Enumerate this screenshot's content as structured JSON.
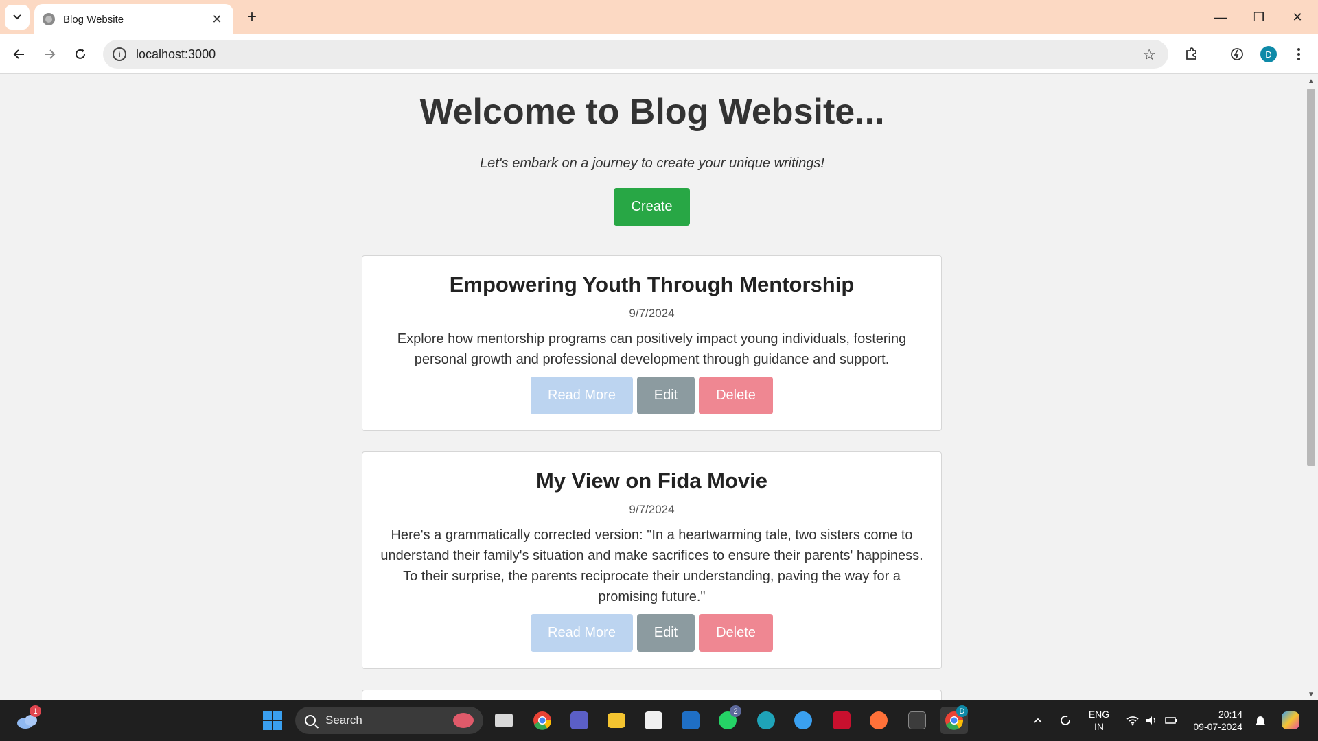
{
  "browser": {
    "tab_title": "Blog Website",
    "tab_close": "✕",
    "new_tab": "+",
    "url": "localhost:3000",
    "window_controls": {
      "minimize": "—",
      "restore": "❐",
      "close": "✕"
    },
    "profile_initial": "D"
  },
  "page": {
    "title": "Welcome to Blog Website...",
    "tagline": "Let's embark on a journey to create your unique writings!",
    "create_label": "Create",
    "posts": [
      {
        "title": "Empowering Youth Through Mentorship",
        "date": "9/7/2024",
        "description": "Explore how mentorship programs can positively impact young individuals, fostering personal growth and professional development through guidance and support.",
        "read_more": "Read More",
        "edit": "Edit",
        "delete": "Delete"
      },
      {
        "title": "My View on Fida Movie",
        "date": "9/7/2024",
        "description": "Here's a grammatically corrected version: \"In a heartwarming tale, two sisters come to understand their family's situation and make sacrifices to ensure their parents' happiness. To their surprise, the parents reciprocate their understanding, paving the way for a promising future.\"",
        "read_more": "Read More",
        "edit": "Edit",
        "delete": "Delete"
      }
    ]
  },
  "taskbar": {
    "weather_badge": "1",
    "search_label": "Search",
    "whatsapp_badge": "2",
    "chrome_badge": "D",
    "language": "ENG",
    "region": "IN",
    "time": "20:14",
    "date": "09-07-2024"
  },
  "colors": {
    "create": "#28a745",
    "read_more": "#bcd4f0",
    "edit": "#8c9ba0",
    "delete": "#ef8792",
    "tabbar": "#fcd9c3"
  }
}
